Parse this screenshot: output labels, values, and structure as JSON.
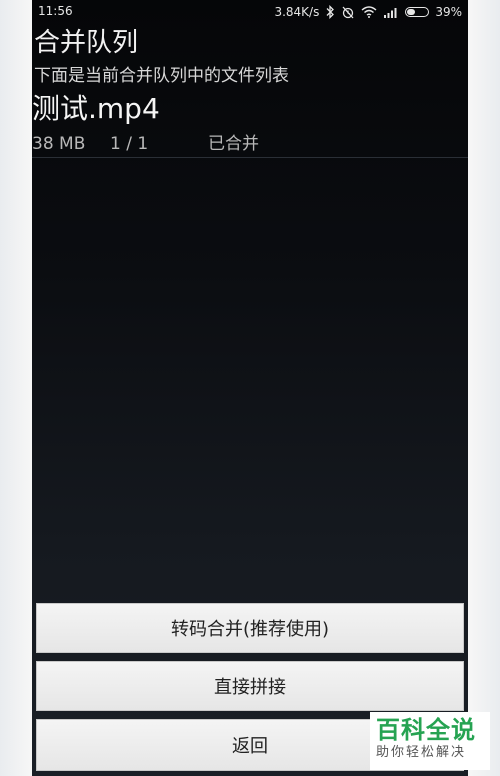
{
  "status_bar": {
    "time": "11:56",
    "net_speed": "3.84K/s",
    "battery_percent": "39%",
    "battery_level": 0.39,
    "icons": [
      "bluetooth-icon",
      "alarm-off-icon",
      "wifi-icon",
      "signal-icon",
      "battery-icon"
    ]
  },
  "screen": {
    "title": "合并队列",
    "subtitle": "下面是当前合并队列中的文件列表"
  },
  "queue": {
    "items": [
      {
        "name": "测试.mp4",
        "size": "38 MB",
        "progress": "1 / 1",
        "status": "已合并"
      }
    ]
  },
  "buttons": {
    "transcode_merge": "转码合并(推荐使用)",
    "direct_concat": "直接拼接",
    "back": "返回"
  },
  "watermark": {
    "title": "百科全说",
    "subtitle": "助你轻松解决"
  },
  "colors": {
    "accent_green": "#26a352",
    "background_dark": "#0b0d11",
    "button_bg": "#eeeeee"
  }
}
